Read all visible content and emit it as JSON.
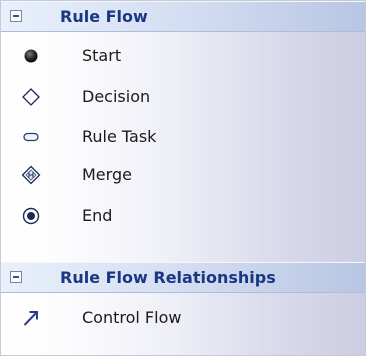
{
  "groups": [
    {
      "title": "Rule Flow",
      "items": [
        {
          "label": "Start",
          "icon": "start-node-icon"
        },
        {
          "label": "Decision",
          "icon": "decision-diamond-icon"
        },
        {
          "label": "Rule Task",
          "icon": "rule-task-icon"
        },
        {
          "label": "Merge",
          "icon": "merge-diamond-icon"
        },
        {
          "label": "End",
          "icon": "end-node-icon"
        }
      ]
    },
    {
      "title": "Rule Flow Relationships",
      "items": [
        {
          "label": "Control Flow",
          "icon": "control-flow-arrow-icon"
        }
      ]
    }
  ]
}
